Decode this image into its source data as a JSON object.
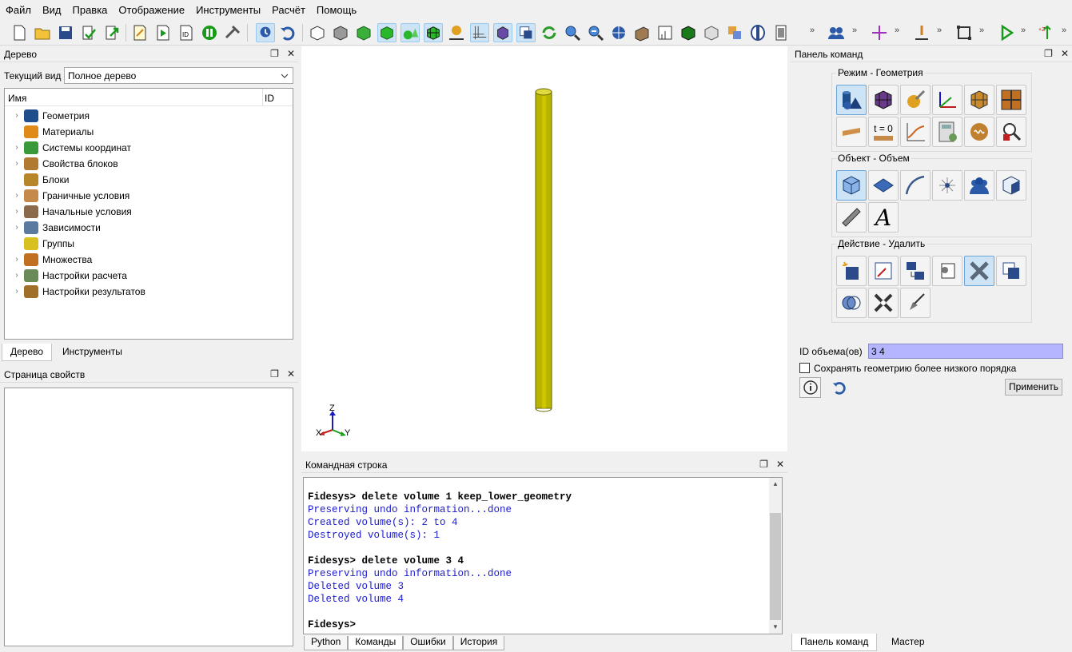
{
  "menu": [
    "Файл",
    "Вид",
    "Правка",
    "Отображение",
    "Инструменты",
    "Расчёт",
    "Помощь"
  ],
  "tree_panel": {
    "title": "Дерево",
    "view_label": "Текущий вид",
    "view_value": "Полное дерево",
    "col_name": "Имя",
    "col_id": "ID",
    "items": [
      {
        "label": "Геометрия",
        "icon": "geometry-icon",
        "color": "#1f4e8c",
        "arrow": "›"
      },
      {
        "label": "Материалы",
        "icon": "materials-icon",
        "color": "#e08a1a",
        "arrow": ""
      },
      {
        "label": "Системы координат",
        "icon": "coordinate-systems-icon",
        "color": "#3a9a3a",
        "arrow": "›"
      },
      {
        "label": "Свойства блоков",
        "icon": "block-properties-icon",
        "color": "#b07a30",
        "arrow": "›"
      },
      {
        "label": "Блоки",
        "icon": "blocks-icon",
        "color": "#b8862a",
        "arrow": ""
      },
      {
        "label": "Граничные условия",
        "icon": "boundary-conditions-icon",
        "color": "#c58a4a",
        "arrow": "›"
      },
      {
        "label": "Начальные условия",
        "icon": "initial-conditions-icon",
        "color": "#8a6a4a",
        "arrow": "›"
      },
      {
        "label": "Зависимости",
        "icon": "dependencies-icon",
        "color": "#5a7aa0",
        "arrow": "›"
      },
      {
        "label": "Группы",
        "icon": "groups-icon",
        "color": "#d8c020",
        "arrow": ""
      },
      {
        "label": "Множества",
        "icon": "sets-icon",
        "color": "#c07020",
        "arrow": "›"
      },
      {
        "label": "Настройки расчета",
        "icon": "calc-settings-icon",
        "color": "#6a8a5a",
        "arrow": "›"
      },
      {
        "label": "Настройки результатов",
        "icon": "results-settings-icon",
        "color": "#a0702a",
        "arrow": "›"
      }
    ],
    "tabs": [
      "Дерево",
      "Инструменты"
    ]
  },
  "properties_panel": {
    "title": "Страница свойств"
  },
  "viewport": {
    "axis_x": "X",
    "axis_y": "Y",
    "axis_z": "Z"
  },
  "command_line": {
    "title": "Командная строка",
    "lines": [
      {
        "type": "prompt",
        "text": "Fidesys> delete volume 1 keep_lower_geometry"
      },
      {
        "type": "out",
        "text": "Preserving undo information...done"
      },
      {
        "type": "out",
        "text": "Created volume(s): 2 to 4"
      },
      {
        "type": "out",
        "text": "Destroyed volume(s): 1"
      },
      {
        "type": "blank",
        "text": " "
      },
      {
        "type": "prompt",
        "text": "Fidesys> delete volume 3 4"
      },
      {
        "type": "out",
        "text": "Preserving undo information...done"
      },
      {
        "type": "out",
        "text": "Deleted volume 3"
      },
      {
        "type": "out",
        "text": "Deleted volume 4"
      },
      {
        "type": "blank",
        "text": " "
      },
      {
        "type": "prompt",
        "text": "Fidesys>"
      }
    ],
    "tabs": [
      "Python",
      "Команды",
      "Ошибки",
      "История"
    ]
  },
  "command_panel": {
    "title": "Панель команд",
    "mode_label": "Режим - Геометрия",
    "object_label": "Объект - Объем",
    "action_label": "Действие - Удалить",
    "t0_label": "t = 0",
    "text_icon_label": "A",
    "id_label": "ID объема(ов)",
    "id_value": "3 4",
    "checkbox_label": "Сохранять геометрию более низкого порядка",
    "apply_label": "Применить",
    "tabs": [
      "Панель команд",
      "Мастер"
    ]
  },
  "colors": {
    "cylinder": "#b8b400",
    "selection": "#cde4f7",
    "output_text": "#1a1ad0",
    "id_field": "#b4b4ff"
  }
}
